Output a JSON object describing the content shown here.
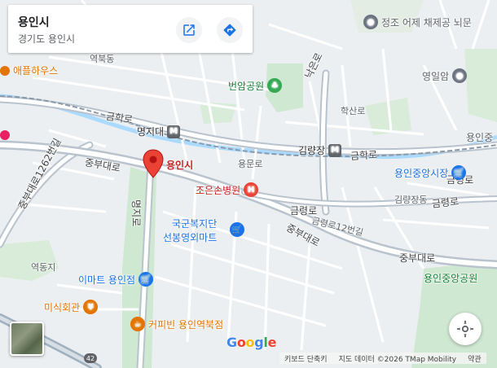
{
  "place_card": {
    "title": "용인시",
    "subtitle": "경기도 용인시",
    "open_label": "",
    "directions_label": ""
  },
  "road_labels": {
    "geumhak_w": "금학로",
    "geumhak_e": "금학로",
    "jungbu_w": "중부대로",
    "jungbu_1262": "중부대로1262번길",
    "jungbu_e": "중부대로",
    "jungbu_se": "중부대로",
    "myeongji": "명지로",
    "yongmun": "용문로",
    "geumnyeong_1": "금령로",
    "geumnyeong_2": "금령로",
    "geumnyeong_12": "금령로12번길",
    "geumnyeong_3": "금령로",
    "naeuro": "낙은로",
    "haksan": "학산로",
    "gimnyang": "김량장동",
    "yeokbuk": "역북동",
    "yeokdong": "역동지",
    "yongin_label": "용인"
  },
  "stations": {
    "myeongji": "명지대",
    "gimnyangjang": "김량장"
  },
  "pois": {
    "jeongjo": "정조 어제 채제공 뇌문",
    "yeongilam": "영일암",
    "apple_house": "애플하우스",
    "beonam_park": "번암공원",
    "joeunson": "조은손병원",
    "gukgun": "국군복지단",
    "seonbong": "선봉영외마트",
    "emart": "이마트 용인점",
    "misik": "미식회관",
    "coffeebean": "커피빈 용인역북점",
    "jungang_market": "용인중앙시장",
    "jungang_market2": "용인중앙시장",
    "yongin_e": "용인중",
    "jungang_south": "용인중앙공원"
  },
  "marker": {
    "label": "용인시",
    "color": "#ea4335"
  },
  "highway_shield": "42",
  "brand": "Google",
  "attribution": {
    "shortcuts": "키보드 단축키",
    "data": "지도 데이터 ©2026 TMap Mobility",
    "terms": "약관"
  },
  "colors": {
    "land": "#eceff1",
    "park": "#cfe8d2",
    "water": "#aadaff",
    "major_road": "#b9c3cd",
    "road": "#ffffff",
    "accent_blue": "#1a73e8",
    "poi_red": "#c5221f",
    "poi_orange": "#e37400",
    "metro": "#5f6368"
  },
  "icons": {
    "open_external": "open-in-new-icon",
    "directions": "directions-icon",
    "locate": "my-location-icon",
    "park": "tree-icon",
    "shop": "shopping-cart-icon",
    "hospital": "hospital-icon",
    "restaurant": "fork-knife-icon",
    "cafe": "coffee-cup-icon",
    "landmark": "place-pin-icon",
    "metro": "metro-icon"
  }
}
